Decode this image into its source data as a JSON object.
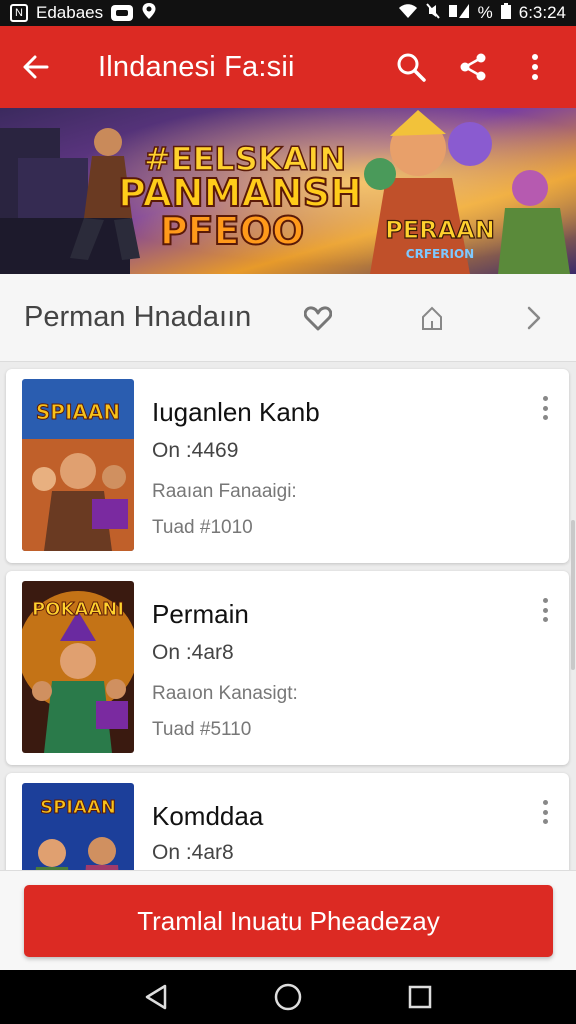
{
  "status_bar": {
    "left_text": "Edabaes",
    "time": "6:3:24",
    "battery_text": "%"
  },
  "app_bar": {
    "title": "Ilndanesi Fa:sii",
    "back_icon": "arrow-back-icon",
    "actions": [
      "search-icon",
      "share-icon",
      "more-vert-icon"
    ]
  },
  "banner": {
    "headline_top": "#EELSKAIN",
    "headline_mid": "PANMANSH",
    "headline_bottom": "PFEOO",
    "badge_main": "PERAAN",
    "badge_sub": "CRFERION"
  },
  "section": {
    "title": "Perman Hnadaıın",
    "icons": [
      "heart-icon",
      "home-icon",
      "chevron-right-icon"
    ]
  },
  "cards": [
    {
      "thumb_text": "SPIAAN",
      "title": "Iuganlen Kanb",
      "line": "On :4469",
      "meta1": "Raaıan Fanaaigi:",
      "meta2": "Tuad #1010",
      "thumb_colors": [
        "#f7c21b",
        "#2a5db0"
      ]
    },
    {
      "thumb_text": "POKAANI",
      "title": "Permain",
      "line": "On :4ar8",
      "meta1": "Raaıon Kanasigt:",
      "meta2": "Tuad #5110",
      "thumb_colors": [
        "#ff9a1a",
        "#3a1a10"
      ]
    },
    {
      "thumb_text": "SPIAAN",
      "title": "Komddaa",
      "line": "On :4ar8",
      "meta1": "",
      "meta2": "",
      "thumb_colors": [
        "#f7c21b",
        "#1c3f9a"
      ]
    }
  ],
  "primary_button": {
    "label": "Tramlal Inuatu Pheadezay"
  },
  "nav": [
    "back-triangle-icon",
    "home-circle-icon",
    "recents-square-icon"
  ],
  "colors": {
    "accent": "#dc2a23",
    "background": "#ececec",
    "card": "#ffffff"
  }
}
